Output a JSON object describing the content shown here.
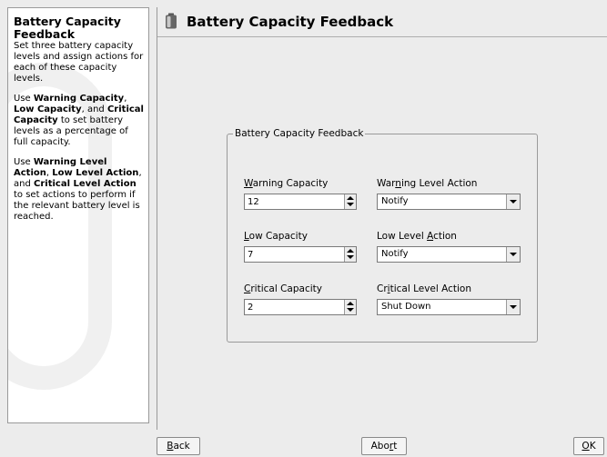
{
  "help": {
    "title": "Battery Capacity Feedback",
    "para1": "Set three battery capacity levels and assign actions for each of these capacity levels.",
    "para2": {
      "t1": "Use ",
      "b1": "Warning Capacity",
      "t2": ", ",
      "b2": "Low Capacity",
      "t3": ", and ",
      "b3": "Critical Capacity",
      "t4": " to set battery levels as a percentage of full capacity."
    },
    "para3": {
      "t1": "Use ",
      "b1": "Warning Level Action",
      "t2": ", ",
      "b2": "Low Level Action",
      "t3": ", and ",
      "b3": "Critical Level Action",
      "t4": " to set actions to perform if the relevant battery level is reached."
    }
  },
  "header": {
    "title": "Battery Capacity Feedback",
    "icon": "battery-icon"
  },
  "group": {
    "legend": "Battery Capacity Feedback",
    "warning_capacity": {
      "label_pre": "",
      "mnemonic": "W",
      "label_post": "arning Capacity",
      "value": "12"
    },
    "warning_action": {
      "label_pre": "War",
      "mnemonic": "n",
      "label_post": "ing Level Action",
      "value": "Notify"
    },
    "low_capacity": {
      "label_pre": "",
      "mnemonic": "L",
      "label_post": "ow Capacity",
      "value": "7"
    },
    "low_action": {
      "label_pre": "Low Level ",
      "mnemonic": "A",
      "label_post": "ction",
      "value": "Notify"
    },
    "critical_capacity": {
      "label_pre": "",
      "mnemonic": "C",
      "label_post": "ritical Capacity",
      "value": "2"
    },
    "critical_action": {
      "label_pre": "Cr",
      "mnemonic": "i",
      "label_post": "tical Level Action",
      "value": "Shut Down"
    }
  },
  "buttons": {
    "back": {
      "mnemonic": "B",
      "rest": "ack"
    },
    "abort": {
      "pre": "Abo",
      "mnemonic": "r",
      "post": "t"
    },
    "ok": {
      "mnemonic": "O",
      "rest": "K"
    }
  }
}
